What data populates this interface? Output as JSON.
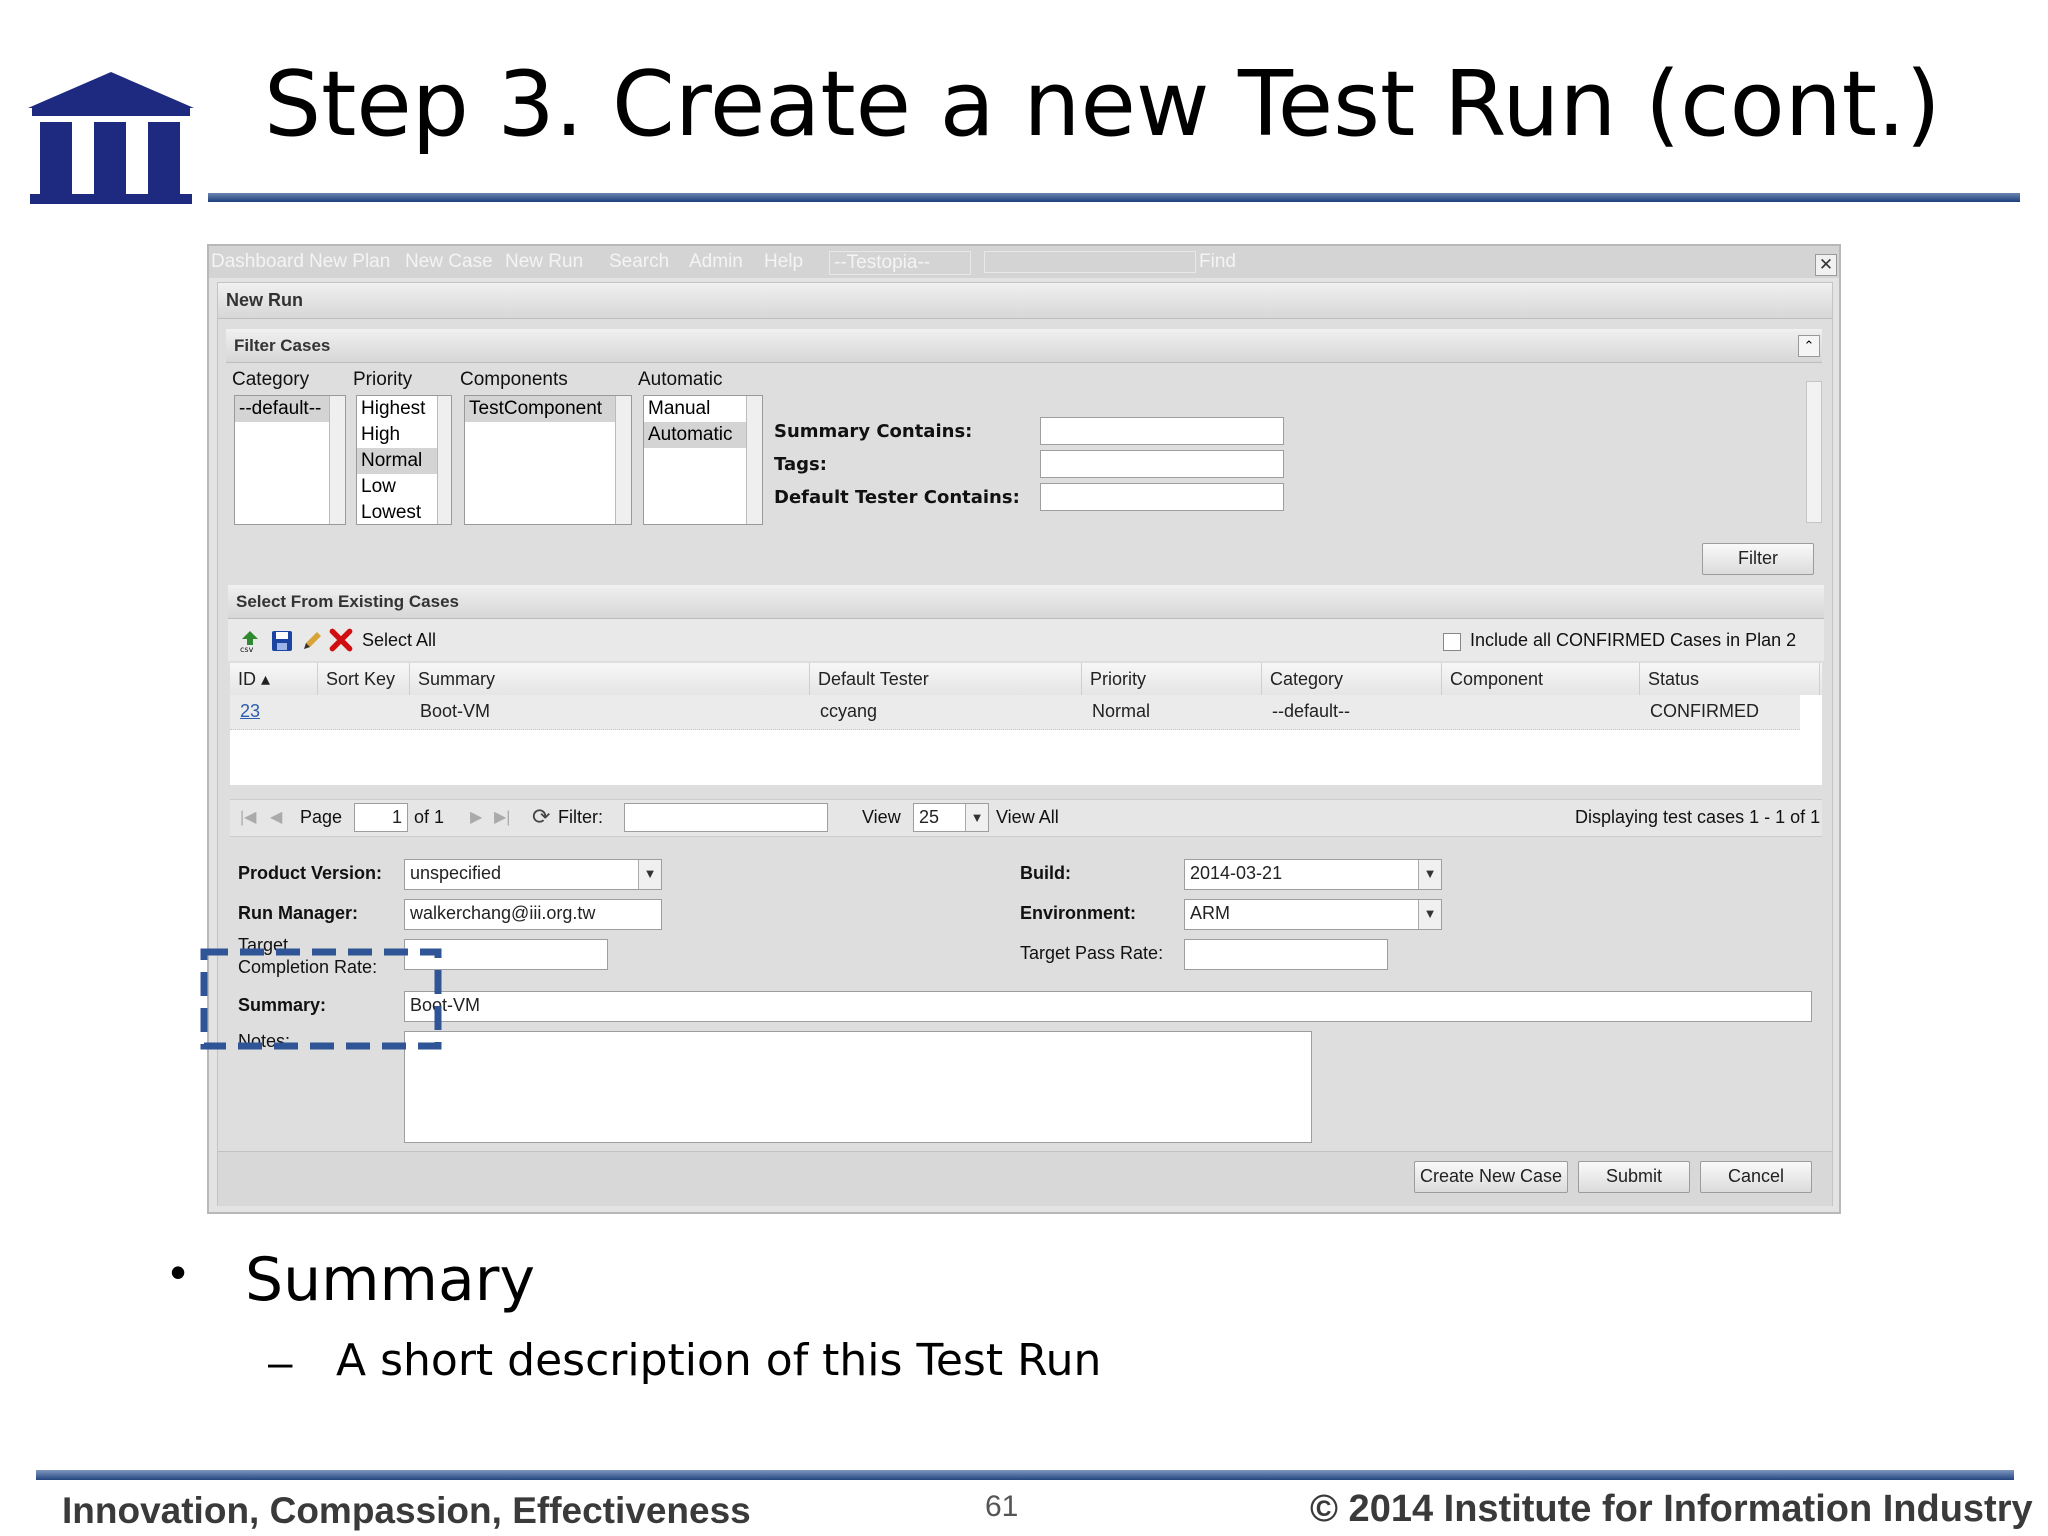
{
  "slide": {
    "title": "Step 3. Create a new Test Run (cont.)",
    "bullet_main": "Summary",
    "bullet_sub": "A short description of this Test Run",
    "footer_left": "Innovation, Compassion, Effectiveness",
    "page_number": "61",
    "footer_right": "© 2014 Institute for Information Industry"
  },
  "nav": {
    "items": [
      "Dashboard",
      "New Plan",
      "New Case",
      "New Run",
      "Search",
      "Admin",
      "Help"
    ],
    "product_select": "--Testopia--",
    "find_button": "Find"
  },
  "window": {
    "title": "New Run"
  },
  "filter": {
    "header": "Filter Cases",
    "category_label": "Category",
    "category_options": [
      "--default--"
    ],
    "category_selected": 0,
    "priority_label": "Priority",
    "priority_options": [
      "Highest",
      "High",
      "Normal",
      "Low",
      "Lowest"
    ],
    "priority_selected": 2,
    "components_label": "Components",
    "components_options": [
      "TestComponent"
    ],
    "components_selected": 0,
    "automatic_label": "Automatic",
    "automatic_options": [
      "Manual",
      "Automatic"
    ],
    "automatic_selected": 1,
    "summary_contains_label": "Summary Contains:",
    "tags_label": "Tags:",
    "default_tester_label": "Default Tester Contains:",
    "summary_contains_value": "",
    "tags_value": "",
    "default_tester_value": "",
    "filter_button": "Filter"
  },
  "cases": {
    "header": "Select From Existing Cases",
    "select_all": "Select All",
    "include_confirmed": "Include all CONFIRMED Cases in Plan 2",
    "columns": [
      "ID",
      "Sort Key",
      "Summary",
      "Default Tester",
      "Priority",
      "Category",
      "Component",
      "Status"
    ],
    "rows": [
      {
        "id": "23",
        "sort_key": "",
        "summary": "Boot-VM",
        "tester": "ccyang",
        "priority": "Normal",
        "category": "--default--",
        "component": "",
        "status": "CONFIRMED"
      }
    ],
    "pager": {
      "page_label": "Page",
      "page_value": "1",
      "of_label": "of 1",
      "filter_label": "Filter:",
      "filter_value": "",
      "view_label": "View",
      "view_value": "25",
      "view_all": "View All",
      "displaying": "Displaying test cases 1 - 1 of 1"
    }
  },
  "form": {
    "product_version_label": "Product Version:",
    "product_version_value": "unspecified",
    "run_manager_label": "Run Manager:",
    "run_manager_value": "walkerchang@iii.org.tw",
    "target_completion_label_1": "Target",
    "target_completion_label_2": "Completion Rate:",
    "target_completion_value": "",
    "summary_label": "Summary:",
    "summary_value": "Boot-VM",
    "notes_label": "Notes:",
    "notes_value": "",
    "build_label": "Build:",
    "build_value": "2014-03-21",
    "environment_label": "Environment:",
    "environment_value": "ARM",
    "target_pass_label": "Target Pass Rate:",
    "target_pass_value": ""
  },
  "buttons": {
    "create_new_case": "Create New Case",
    "submit": "Submit",
    "cancel": "Cancel"
  },
  "colors": {
    "title_rule": "#1f3f7a",
    "highlight_box": "#2f5597",
    "link": "#2a5db0",
    "delete_icon": "#d01010"
  }
}
